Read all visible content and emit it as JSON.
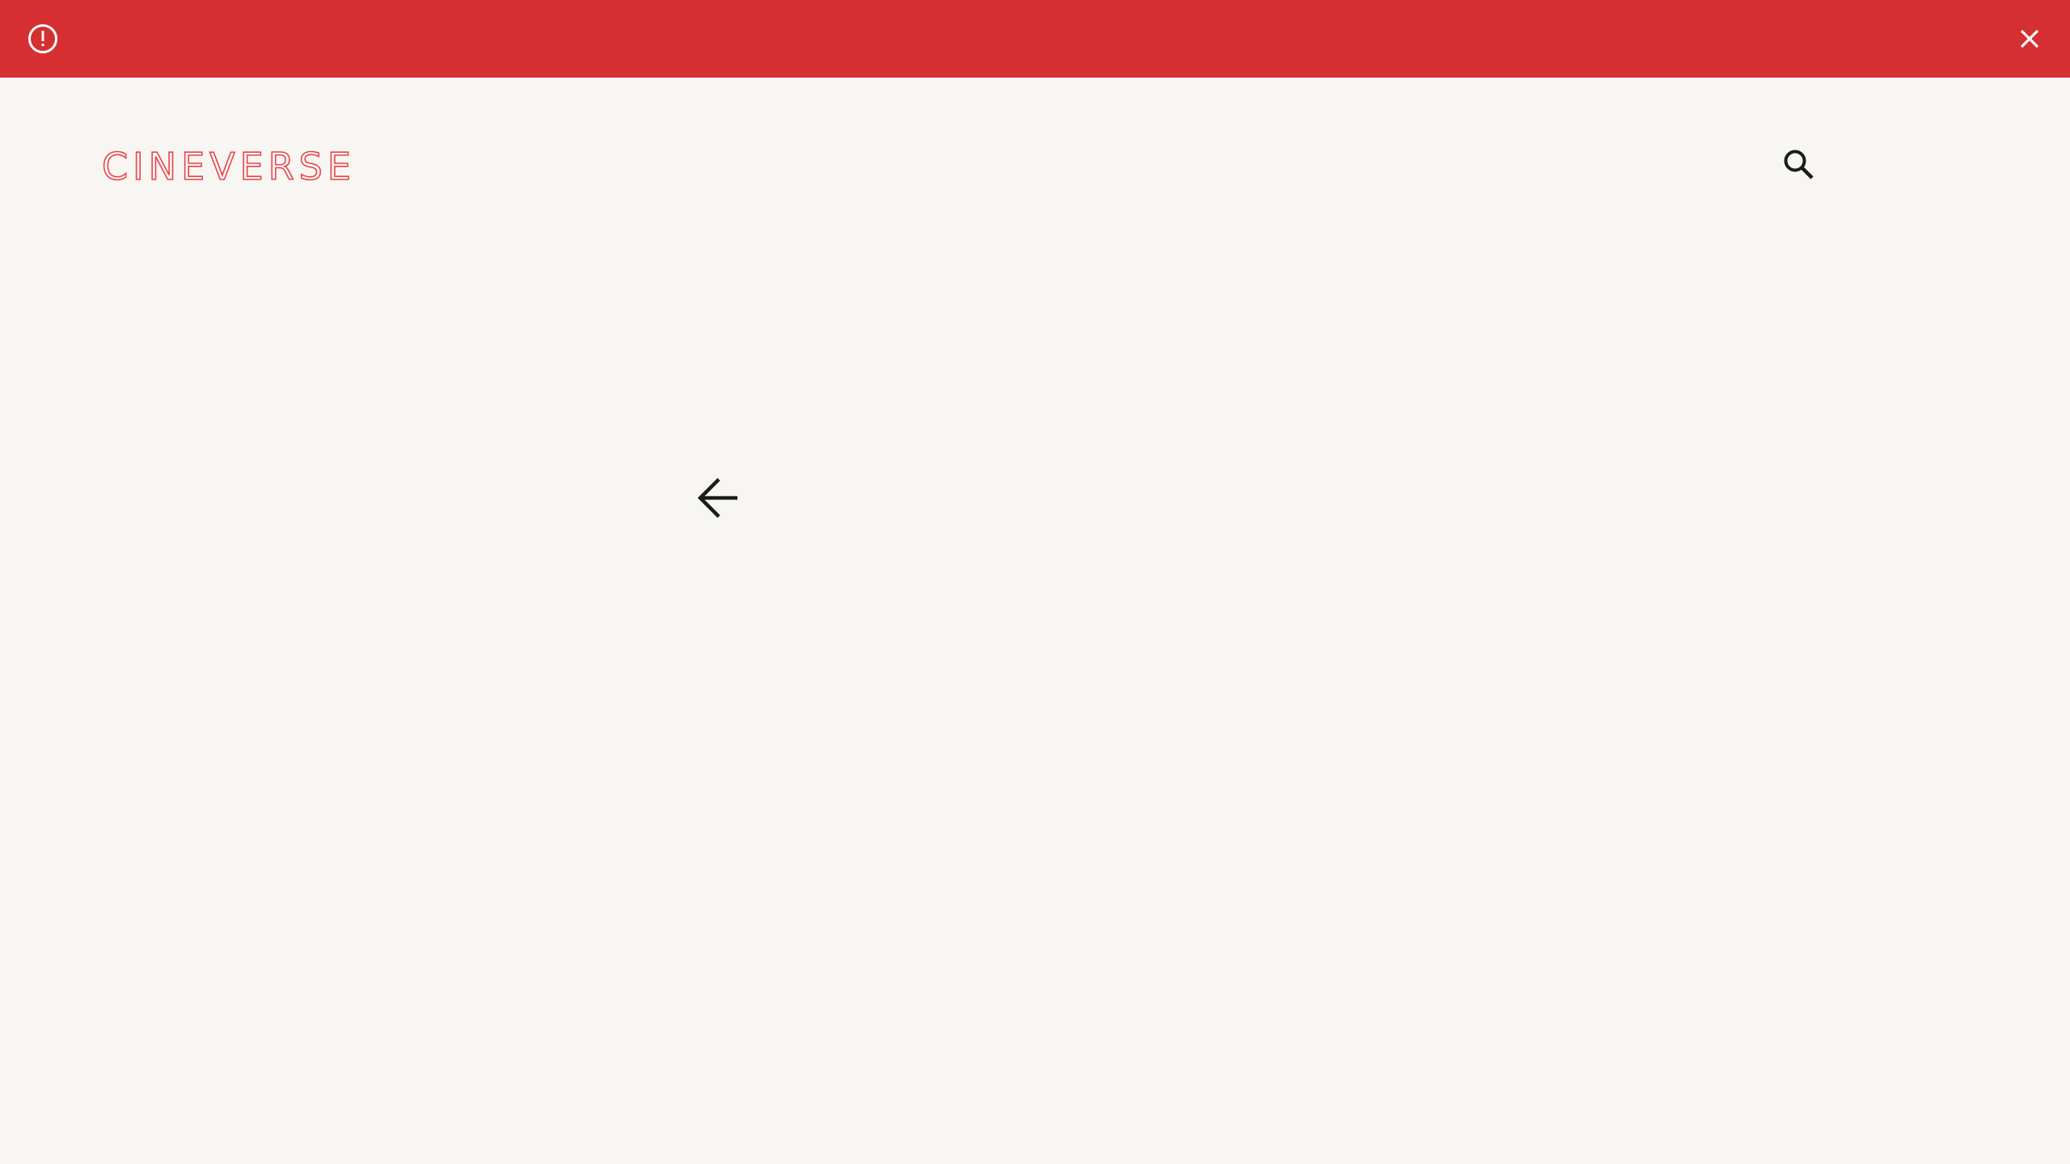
{
  "alert": {
    "icon": "alert-circle-icon",
    "message": "",
    "close_icon": "close-icon",
    "color": "#d52f31"
  },
  "header": {
    "logo_text": "CINEVERSE",
    "logo_color": "#e8454a",
    "search_icon": "search-icon"
  },
  "main": {
    "back_icon": "arrow-left-icon"
  },
  "colors": {
    "background": "#f7f6f3",
    "icon_dark": "#1b1b1b",
    "alert_foreground": "#ffffff"
  }
}
